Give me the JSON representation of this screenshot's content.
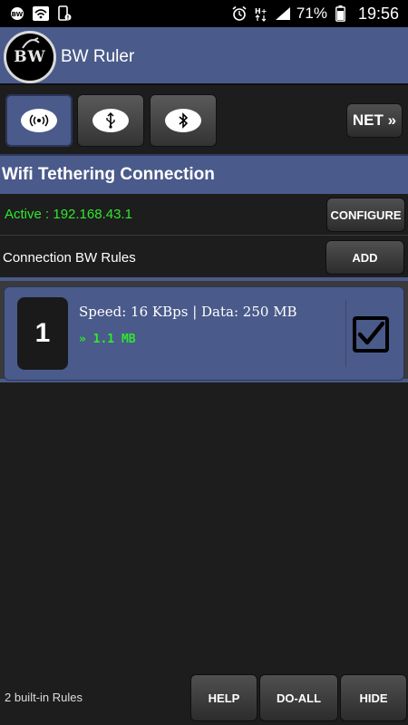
{
  "status_bar": {
    "battery_percent": "71%",
    "time": "19:56",
    "left_icons": [
      "app-notification-icon",
      "wifi-icon",
      "phone-data-icon"
    ],
    "right_icons": [
      "alarm-icon",
      "hplus-icon",
      "signal-icon",
      "battery-icon"
    ]
  },
  "app": {
    "logo_text": "BW",
    "title": "BW Ruler"
  },
  "toolbar": {
    "modes": [
      {
        "icon": "wifi-tethering-icon",
        "active": true
      },
      {
        "icon": "usb-icon",
        "active": false
      },
      {
        "icon": "bluetooth-icon",
        "active": false
      }
    ],
    "net_label": "NET »"
  },
  "connection": {
    "section_title": "Wifi Tethering Connection",
    "active_text": "Active : 192.168.43.1",
    "configure_label": "CONFIGURE",
    "rules_label": "Connection BW Rules",
    "add_label": "ADD"
  },
  "rules": [
    {
      "number": "1",
      "speed_text": "Speed: 16 KBps | Data: 250 MB",
      "usage_text": "» 1.1 MB",
      "checked": true
    }
  ],
  "footer": {
    "built_in_text": "2 built-in Rules",
    "help_label": "HELP",
    "doall_label": "DO-ALL",
    "hide_label": "HIDE"
  },
  "colors": {
    "accent": "#4a5a8a",
    "background": "#1d1d1d",
    "active_green": "#2ee82e"
  }
}
